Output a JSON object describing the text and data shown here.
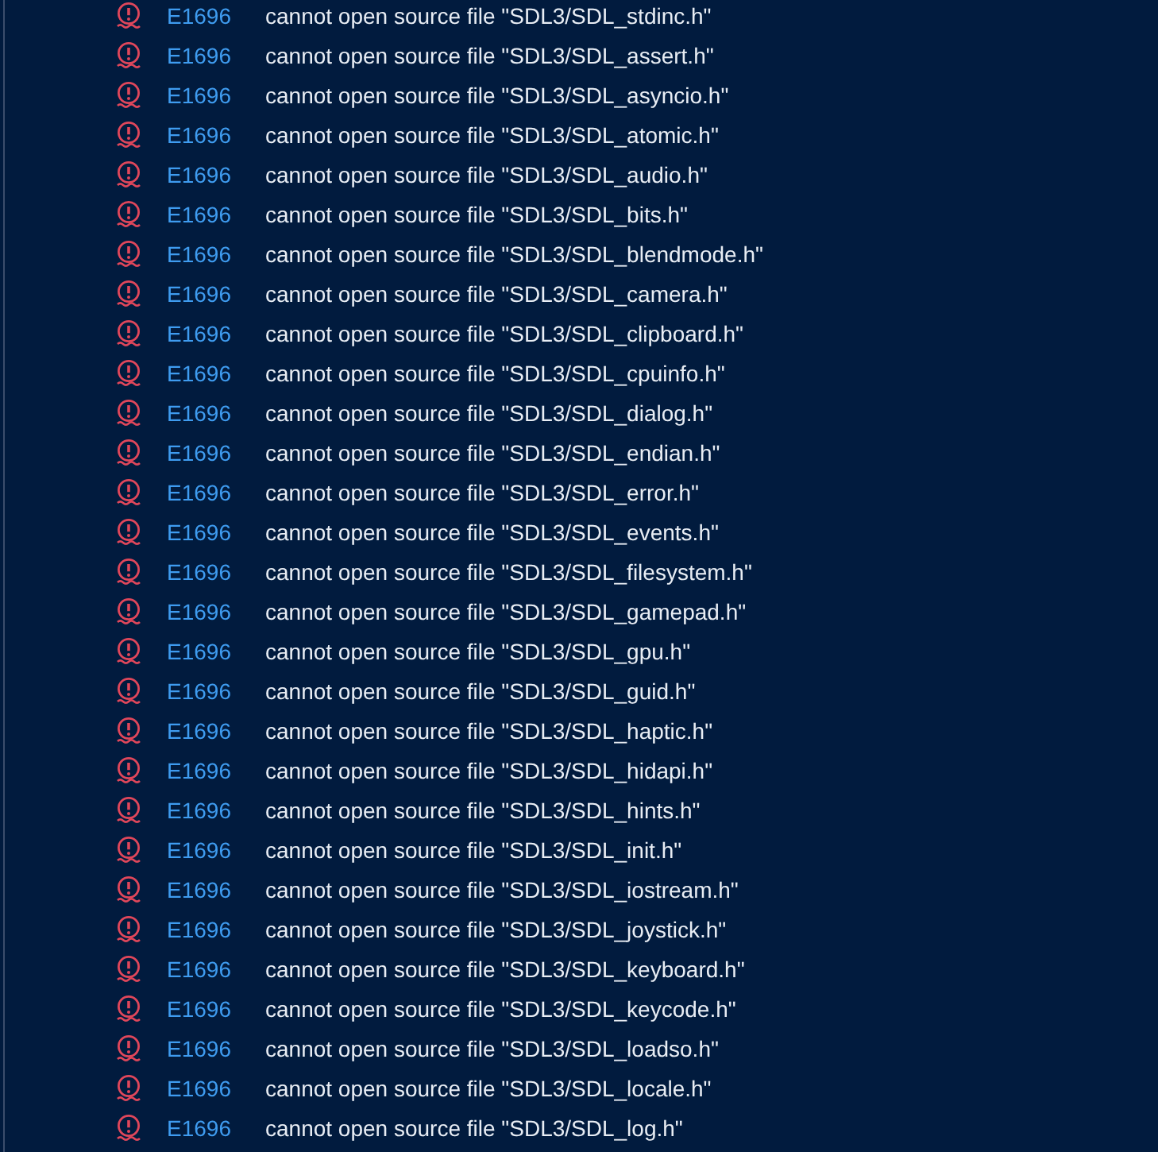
{
  "rows": [
    {
      "kind": "error",
      "code": "E1696",
      "message": "cannot open source file \"SDL3/SDL_stdinc.h\""
    },
    {
      "kind": "error",
      "code": "E1696",
      "message": "cannot open source file \"SDL3/SDL_assert.h\""
    },
    {
      "kind": "error",
      "code": "E1696",
      "message": "cannot open source file \"SDL3/SDL_asyncio.h\""
    },
    {
      "kind": "error",
      "code": "E1696",
      "message": "cannot open source file \"SDL3/SDL_atomic.h\""
    },
    {
      "kind": "error",
      "code": "E1696",
      "message": "cannot open source file \"SDL3/SDL_audio.h\""
    },
    {
      "kind": "error",
      "code": "E1696",
      "message": "cannot open source file \"SDL3/SDL_bits.h\""
    },
    {
      "kind": "error",
      "code": "E1696",
      "message": "cannot open source file \"SDL3/SDL_blendmode.h\""
    },
    {
      "kind": "error",
      "code": "E1696",
      "message": "cannot open source file \"SDL3/SDL_camera.h\""
    },
    {
      "kind": "error",
      "code": "E1696",
      "message": "cannot open source file \"SDL3/SDL_clipboard.h\""
    },
    {
      "kind": "error",
      "code": "E1696",
      "message": "cannot open source file \"SDL3/SDL_cpuinfo.h\""
    },
    {
      "kind": "error",
      "code": "E1696",
      "message": "cannot open source file \"SDL3/SDL_dialog.h\""
    },
    {
      "kind": "error",
      "code": "E1696",
      "message": "cannot open source file \"SDL3/SDL_endian.h\""
    },
    {
      "kind": "error",
      "code": "E1696",
      "message": "cannot open source file \"SDL3/SDL_error.h\""
    },
    {
      "kind": "error",
      "code": "E1696",
      "message": "cannot open source file \"SDL3/SDL_events.h\""
    },
    {
      "kind": "error",
      "code": "E1696",
      "message": "cannot open source file \"SDL3/SDL_filesystem.h\""
    },
    {
      "kind": "error",
      "code": "E1696",
      "message": "cannot open source file \"SDL3/SDL_gamepad.h\""
    },
    {
      "kind": "error",
      "code": "E1696",
      "message": "cannot open source file \"SDL3/SDL_gpu.h\""
    },
    {
      "kind": "error",
      "code": "E1696",
      "message": "cannot open source file \"SDL3/SDL_guid.h\""
    },
    {
      "kind": "error",
      "code": "E1696",
      "message": "cannot open source file \"SDL3/SDL_haptic.h\""
    },
    {
      "kind": "error",
      "code": "E1696",
      "message": "cannot open source file \"SDL3/SDL_hidapi.h\""
    },
    {
      "kind": "error",
      "code": "E1696",
      "message": "cannot open source file \"SDL3/SDL_hints.h\""
    },
    {
      "kind": "error",
      "code": "E1696",
      "message": "cannot open source file \"SDL3/SDL_init.h\""
    },
    {
      "kind": "error",
      "code": "E1696",
      "message": "cannot open source file \"SDL3/SDL_iostream.h\""
    },
    {
      "kind": "error",
      "code": "E1696",
      "message": "cannot open source file \"SDL3/SDL_joystick.h\""
    },
    {
      "kind": "error",
      "code": "E1696",
      "message": "cannot open source file \"SDL3/SDL_keyboard.h\""
    },
    {
      "kind": "error",
      "code": "E1696",
      "message": "cannot open source file \"SDL3/SDL_keycode.h\""
    },
    {
      "kind": "error",
      "code": "E1696",
      "message": "cannot open source file \"SDL3/SDL_loadso.h\""
    },
    {
      "kind": "error",
      "code": "E1696",
      "message": "cannot open source file \"SDL3/SDL_locale.h\""
    },
    {
      "kind": "error",
      "code": "E1696",
      "message": "cannot open source file \"SDL3/SDL_log.h\""
    }
  ]
}
